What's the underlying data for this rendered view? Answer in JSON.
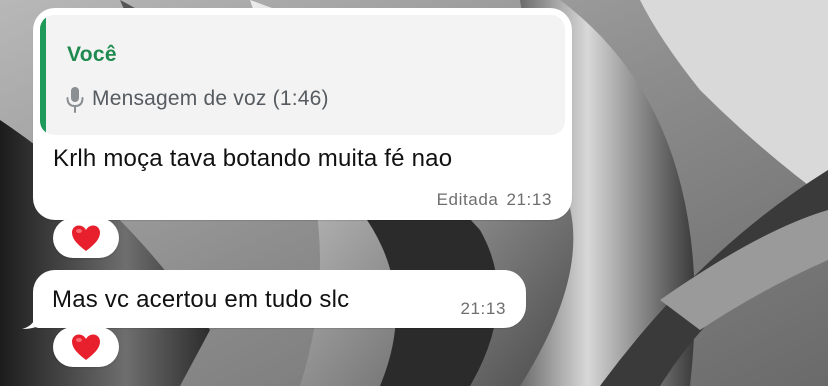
{
  "chat": {
    "messages": [
      {
        "reply_quote": {
          "author": "Você",
          "icon": "microphone-icon",
          "text": "Mensagem de voz (1:46)",
          "accent_color": "#1f9a5a"
        },
        "text": "Krlh moça tava botando muita fé nao",
        "edited_label": "Editada",
        "time": "21:13",
        "reaction": "❤️"
      },
      {
        "text": "Mas vc acertou em tudo slc",
        "time": "21:13",
        "reaction": "❤️"
      }
    ]
  },
  "colors": {
    "bubble": "#ffffff",
    "quote_background": "#f3f3f3",
    "quote_author": "#1f8a4f",
    "heart": "#e8202e"
  }
}
